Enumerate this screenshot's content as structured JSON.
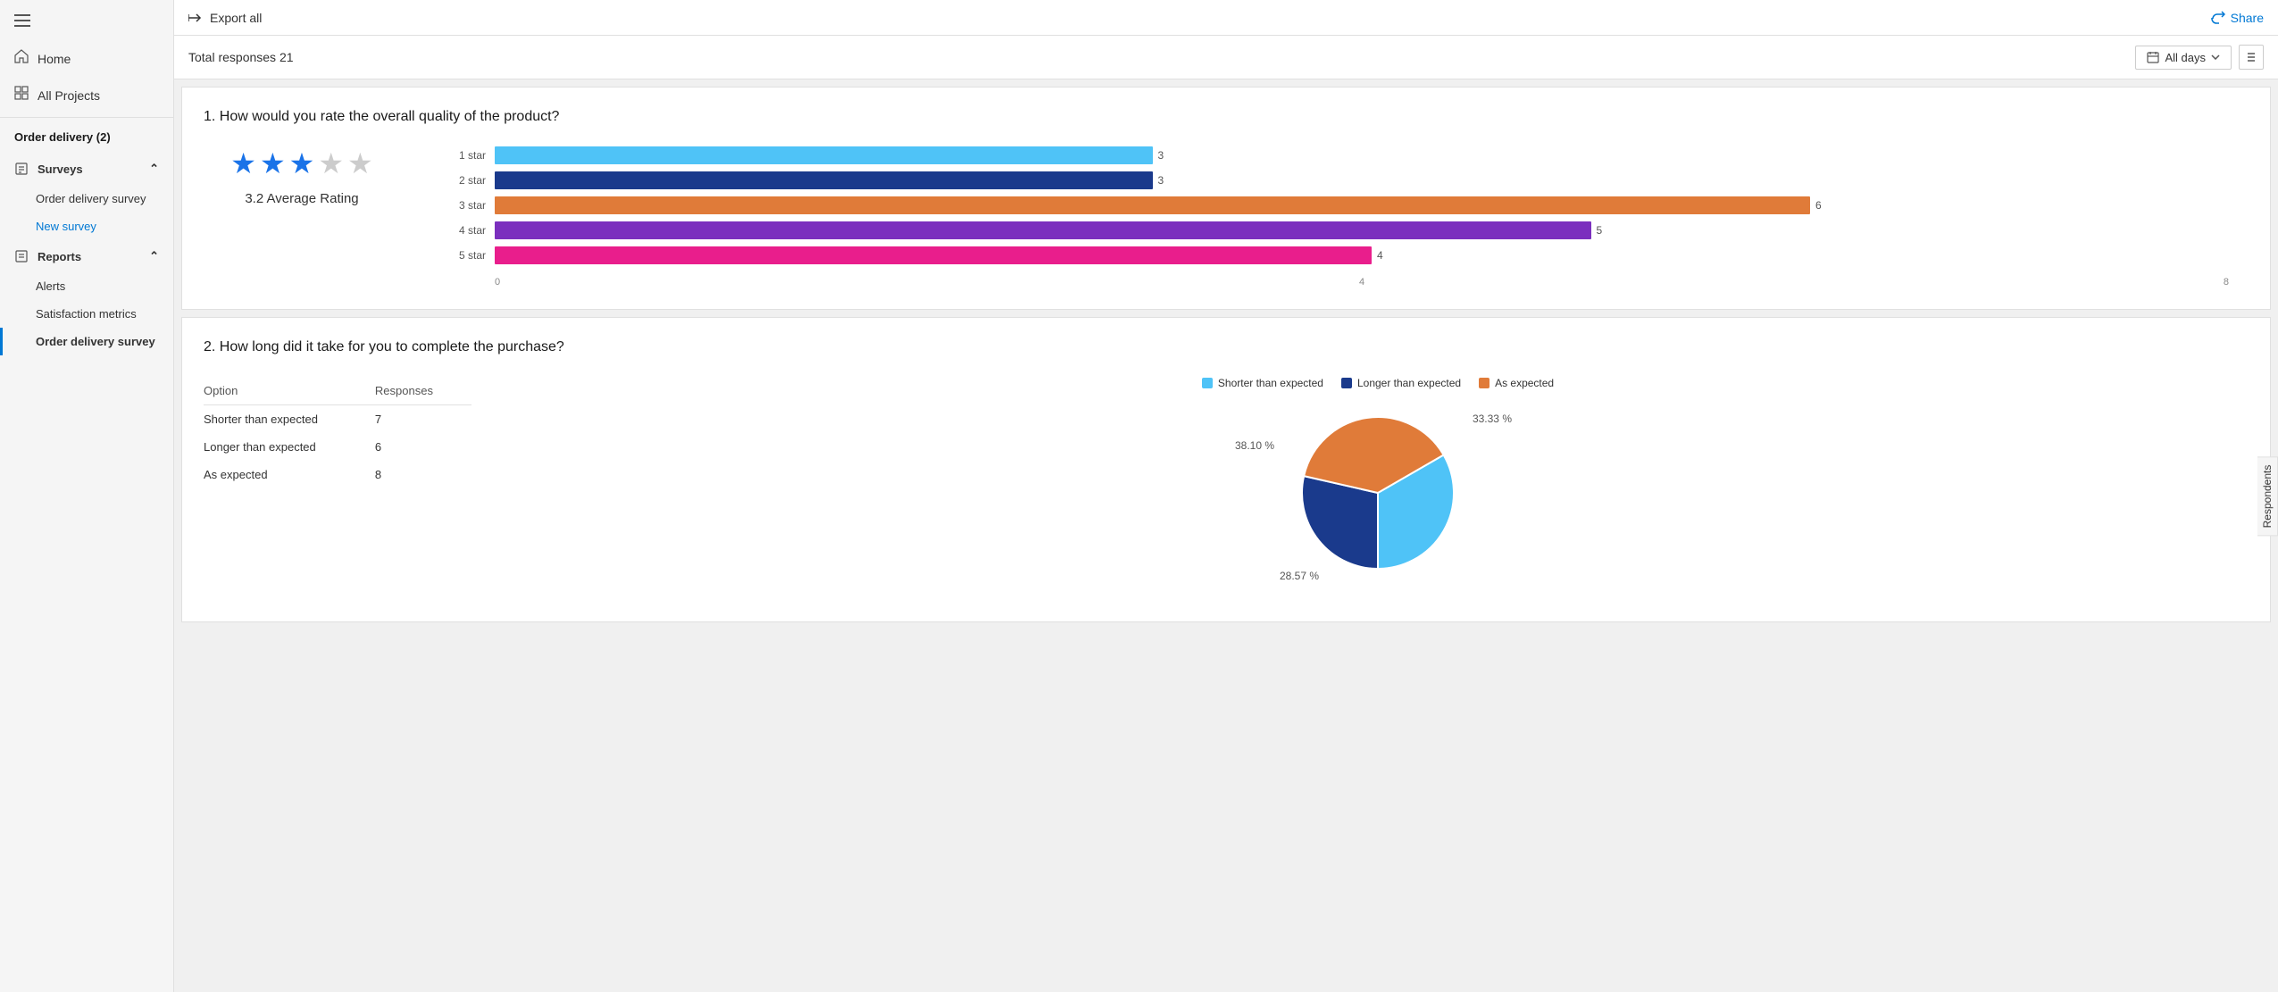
{
  "sidebar": {
    "menu_icon": "☰",
    "home_label": "Home",
    "all_projects_label": "All Projects",
    "order_delivery": "Order delivery (2)",
    "surveys_label": "Surveys",
    "survey_items": [
      {
        "label": "Order delivery survey"
      },
      {
        "label": "New survey",
        "active": "blue"
      }
    ],
    "reports_label": "Reports",
    "report_items": [
      {
        "label": "Alerts"
      },
      {
        "label": "Satisfaction metrics"
      },
      {
        "label": "Order delivery survey",
        "active": "selected"
      }
    ]
  },
  "toolbar": {
    "export_label": "Export all",
    "share_label": "Share",
    "export_icon": "→",
    "share_icon": "↗"
  },
  "sub_header": {
    "total_responses": "Total responses 21",
    "filter_label": "All days",
    "calendar_icon": "📅"
  },
  "right_panel": {
    "label": "Respondents"
  },
  "question1": {
    "title": "1. How would you rate the overall quality of the product?",
    "stars_filled": 3,
    "stars_empty": 2,
    "average_rating": "3.2 Average Rating",
    "bars": [
      {
        "label": "1 star",
        "value": 3,
        "color": "#4fc3f7",
        "max": 8
      },
      {
        "label": "2 star",
        "value": 3,
        "color": "#1a3a8c",
        "max": 8
      },
      {
        "label": "3 star",
        "value": 6,
        "color": "#e07b39",
        "max": 8
      },
      {
        "label": "4 star",
        "value": 5,
        "color": "#7b2fbe",
        "max": 8
      },
      {
        "label": "5 star",
        "value": 4,
        "color": "#e91e8c",
        "max": 8
      }
    ],
    "axis_labels": [
      "0",
      "4",
      "8"
    ]
  },
  "question2": {
    "title": "2. How long did it take for you to complete the purchase?",
    "table_headers": [
      "Option",
      "Responses"
    ],
    "table_rows": [
      {
        "option": "Shorter than expected",
        "responses": "7"
      },
      {
        "option": "Longer than expected",
        "responses": "6"
      },
      {
        "option": "As expected",
        "responses": "8"
      }
    ],
    "pie": {
      "legend": [
        {
          "label": "Shorter than expected",
          "color": "#4fc3f7"
        },
        {
          "label": "Longer than expected",
          "color": "#1a3a8c"
        },
        {
          "label": "As expected",
          "color": "#e07b39"
        }
      ],
      "slices": [
        {
          "label": "33.33 %",
          "percent": 33.33,
          "color": "#4fc3f7"
        },
        {
          "label": "28.57 %",
          "percent": 28.57,
          "color": "#1a3a8c"
        },
        {
          "label": "38.10 %",
          "percent": 38.1,
          "color": "#e07b39"
        }
      ]
    }
  }
}
